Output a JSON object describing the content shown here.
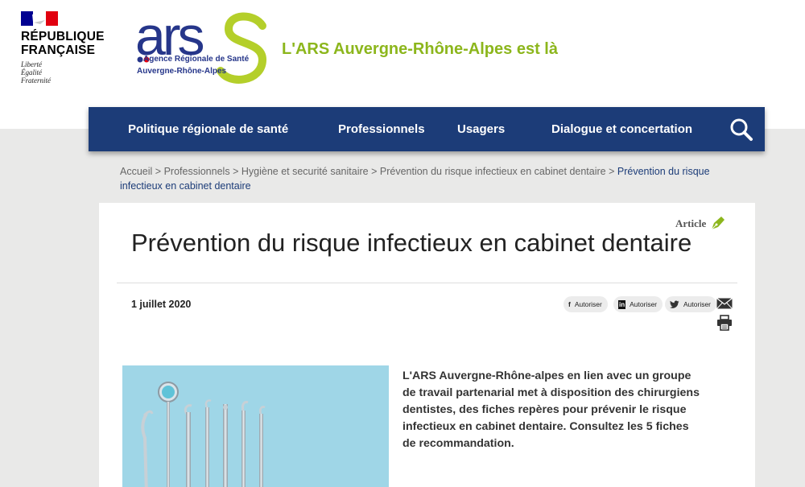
{
  "header": {
    "republic": {
      "name_line1": "RÉPUBLIQUE",
      "name_line2": "FRANÇAISE",
      "motto": [
        "Liberté",
        "Égalité",
        "Fraternité"
      ]
    },
    "ars": {
      "wordmark": "ars",
      "agency": "Agence Régionale de Santé",
      "region": "Auvergne-Rhône-Alpes"
    },
    "tagline": "L'ARS Auvergne-Rhône-Alpes est là"
  },
  "nav": {
    "items": [
      "Politique régionale de santé",
      "Professionnels",
      "Usagers",
      "Dialogue et concertation"
    ],
    "search_icon": "search-icon"
  },
  "breadcrumb": {
    "items": [
      "Accueil",
      "Professionnels",
      "Hygiène et securité sanitaire",
      "Prévention du risque infectieux en cabinet dentaire"
    ],
    "current": "Prévention du risque infectieux en cabinet dentaire",
    "separator": ">"
  },
  "article": {
    "type": "Article",
    "title": "Prévention du risque infectieux en cabinet dentaire",
    "date": "1 juillet 2020",
    "share": {
      "facebook": "Autoriser",
      "linkedin": "Autoriser",
      "twitter": "Autoriser"
    },
    "intro": "L'ARS Auvergne-Rhône-alpes en lien avec un groupe de travail partenarial met à disposition des chirurgiens dentistes, des fiches repères pour prévenir le risque infectieux en cabinet dentaire. Consultez les 5 fiches de recommandation."
  },
  "colors": {
    "nav_bg": "#1c3c78",
    "tagline": "#8cb61c",
    "ars_blue": "#26368a",
    "ars_green": "#b4cf2a"
  }
}
